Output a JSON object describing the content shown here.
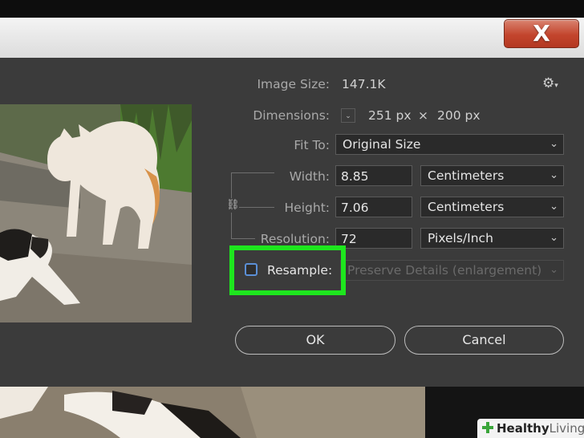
{
  "window": {
    "close_glyph": "X"
  },
  "image_size": {
    "label": "Image Size:",
    "value": "147.1K"
  },
  "dimensions": {
    "label": "Dimensions:",
    "width": "251 px",
    "times": "×",
    "height": "200 px"
  },
  "fit_to": {
    "label": "Fit To:",
    "value": "Original Size"
  },
  "width": {
    "label": "Width:",
    "value": "8.85",
    "unit": "Centimeters"
  },
  "height": {
    "label": "Height:",
    "value": "7.06",
    "unit": "Centimeters"
  },
  "resolution": {
    "label": "Resolution:",
    "value": "72",
    "unit": "Pixels/Inch"
  },
  "resample": {
    "label": "Resample:",
    "checked": false,
    "method": "Preserve Details (enlargement)"
  },
  "buttons": {
    "ok": "OK",
    "cancel": "Cancel"
  },
  "watermark": {
    "brand_bold": "Healthy",
    "brand_light": "Living"
  },
  "colors": {
    "highlight": "#1ee61e",
    "close_button": "#c3452d",
    "dialog_bg": "#3b3b3b"
  },
  "icons": {
    "settings": "gear-icon",
    "chain": "chain-link-icon",
    "dropdown": "chevron-down-icon"
  }
}
